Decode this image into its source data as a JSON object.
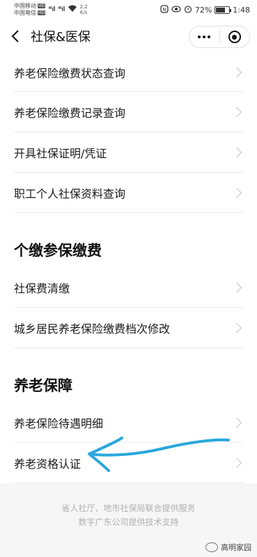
{
  "status_bar": {
    "carrier1": "中国移动",
    "carrier2": "中国电信",
    "hd": "HD",
    "signal1": "⁴⁶ıll",
    "signal2": "⁴⁶ıll",
    "speed_value": "2.2",
    "speed_unit": "K/s",
    "battery_percent": "72%",
    "time": "1:48"
  },
  "nav": {
    "title": "社保&医保"
  },
  "group1": {
    "items": [
      {
        "label": "养老保险缴费状态查询"
      },
      {
        "label": "养老保险缴费记录查询"
      },
      {
        "label": "开具社保证明/凭证"
      },
      {
        "label": "职工个人社保资料查询"
      }
    ]
  },
  "group2": {
    "title": "个缴参保缴费",
    "items": [
      {
        "label": "社保费清缴"
      },
      {
        "label": "城乡居民养老保险缴费档次修改"
      }
    ]
  },
  "group3": {
    "title": "养老保障",
    "items": [
      {
        "label": "养老保险待遇明细"
      },
      {
        "label": "养老资格认证"
      }
    ]
  },
  "footer": {
    "line1": "省人社厅、地市社保局联合提供服务",
    "line2": "数字广东公司提供技术支持"
  },
  "watermark": {
    "text": "高明家园"
  },
  "colors": {
    "annotation_arrow": "#2aa7dc",
    "text": "#1a1a1a",
    "footer_text": "#b0b0b0"
  }
}
